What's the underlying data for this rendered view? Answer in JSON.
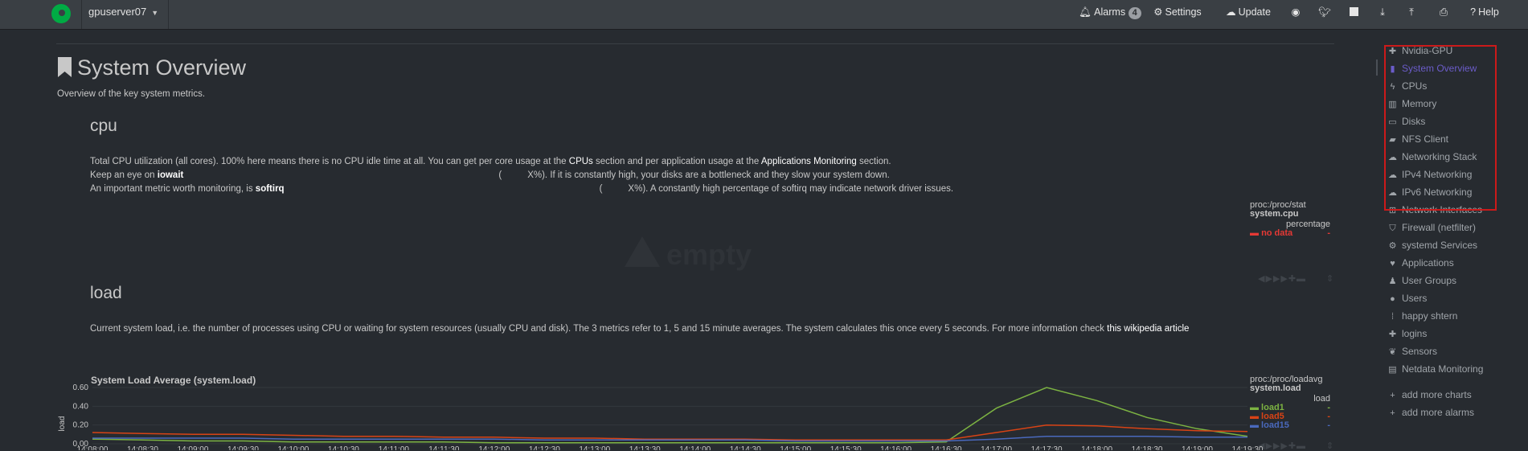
{
  "topbar": {
    "server": "gpuserver07",
    "alarms_label": "Alarms",
    "alarms_count": "4",
    "settings": "Settings",
    "update": "Update",
    "help": "Help"
  },
  "page": {
    "title": "System Overview",
    "subtitle": "Overview of the key system metrics."
  },
  "cpu": {
    "title": "cpu",
    "line1_a": "Total CPU utilization (all cores). 100% here means there is no CPU idle time at all. You can get per core usage at the ",
    "line1_link1": "CPUs",
    "line1_b": " section and per application usage at the ",
    "line1_link2": "Applications Monitoring",
    "line1_c": " section.",
    "line2_a": "Keep an eye on ",
    "line2_b": "iowait",
    "line2_c": "(",
    "line2_d": "X%). If it is constantly high, your disks are a bottleneck and they slow your system down.",
    "line3_a": "An important metric worth monitoring, is ",
    "line3_b": "softirq",
    "line3_c": "(",
    "line3_d": "X%). A constantly high percentage of softirq may indicate network driver issues.",
    "empty_text": "empty",
    "legend_source": "proc:/proc/stat",
    "legend_chart": "system.cpu",
    "legend_units": "percentage",
    "legend_item": "no data",
    "legend_value": "-"
  },
  "load": {
    "title": "load",
    "desc_a": "Current system load, i.e. the number of processes using CPU or waiting for system resources (usually CPU and disk). The 3 metrics refer to 1, 5 and 15 minute averages. The system calculates this once every 5 seconds. For more information check ",
    "desc_link": "this wikipedia article",
    "chart_title": "System Load Average (system.load)",
    "ylabel": "load",
    "legend_source": "proc:/proc/loadavg",
    "legend_chart": "system.load",
    "legend_units": "load"
  },
  "chart_data": {
    "type": "line",
    "title": "System Load Average (system.load)",
    "ylabel": "load",
    "ylim": [
      0,
      0.6
    ],
    "yticks": [
      "0.60",
      "0.40",
      "0.20",
      "0.00"
    ],
    "x": [
      "14:08:00",
      "14:08:30",
      "14:09:00",
      "14:09:30",
      "14:10:00",
      "14:10:30",
      "14:11:00",
      "14:11:30",
      "14:12:00",
      "14:12:30",
      "14:13:00",
      "14:13:30",
      "14:14:00",
      "14:14:30",
      "14:15:00",
      "14:15:30",
      "14:16:00",
      "14:16:30",
      "14:17:00",
      "14:17:30",
      "14:18:00",
      "14:18:30",
      "14:19:00",
      "14:19:30"
    ],
    "series": [
      {
        "name": "load1",
        "color": "#7cb342",
        "values": [
          0.05,
          0.04,
          0.03,
          0.03,
          0.02,
          0.02,
          0.02,
          0.02,
          0.01,
          0.01,
          0.01,
          0.01,
          0.01,
          0.01,
          0.01,
          0.01,
          0.01,
          0.02,
          0.38,
          0.6,
          0.46,
          0.28,
          0.16,
          0.08
        ]
      },
      {
        "name": "load5",
        "color": "#d84315",
        "values": [
          0.12,
          0.11,
          0.1,
          0.1,
          0.09,
          0.08,
          0.08,
          0.07,
          0.07,
          0.06,
          0.06,
          0.05,
          0.05,
          0.05,
          0.04,
          0.04,
          0.04,
          0.04,
          0.12,
          0.2,
          0.19,
          0.16,
          0.14,
          0.13
        ]
      },
      {
        "name": "load15",
        "color": "#4a69bd",
        "values": [
          0.06,
          0.06,
          0.06,
          0.06,
          0.05,
          0.05,
          0.05,
          0.05,
          0.05,
          0.04,
          0.04,
          0.04,
          0.04,
          0.04,
          0.03,
          0.03,
          0.03,
          0.03,
          0.05,
          0.08,
          0.08,
          0.08,
          0.07,
          0.07
        ]
      }
    ]
  },
  "sidebar": {
    "items": [
      {
        "label": "Nvidia-GPU",
        "icon": "puzzle-icon"
      },
      {
        "label": "System Overview",
        "icon": "bookmark-icon"
      },
      {
        "label": "CPUs",
        "icon": "bolt-icon"
      },
      {
        "label": "Memory",
        "icon": "memory-icon"
      },
      {
        "label": "Disks",
        "icon": "hdd-icon"
      },
      {
        "label": "NFS Client",
        "icon": "folder-icon"
      },
      {
        "label": "Networking Stack",
        "icon": "cloud-icon"
      },
      {
        "label": "IPv4 Networking",
        "icon": "cloud-icon"
      },
      {
        "label": "IPv6 Networking",
        "icon": "cloud-icon"
      },
      {
        "label": "Network Interfaces",
        "icon": "sitemap-icon"
      },
      {
        "label": "Firewall (netfilter)",
        "icon": "shield-icon"
      },
      {
        "label": "systemd Services",
        "icon": "cogs-icon"
      },
      {
        "label": "Applications",
        "icon": "heartbeat-icon"
      },
      {
        "label": "User Groups",
        "icon": "users-icon"
      },
      {
        "label": "Users",
        "icon": "user-icon"
      },
      {
        "label": "happy shtern",
        "icon": "grid-icon"
      },
      {
        "label": "logins",
        "icon": "puzzle-icon"
      },
      {
        "label": "Sensors",
        "icon": "leaf-icon"
      },
      {
        "label": "Netdata Monitoring",
        "icon": "chart-icon"
      },
      {
        "label": "add more charts",
        "icon": "plus-icon"
      },
      {
        "label": "add more alarms",
        "icon": "plus-icon"
      }
    ]
  }
}
